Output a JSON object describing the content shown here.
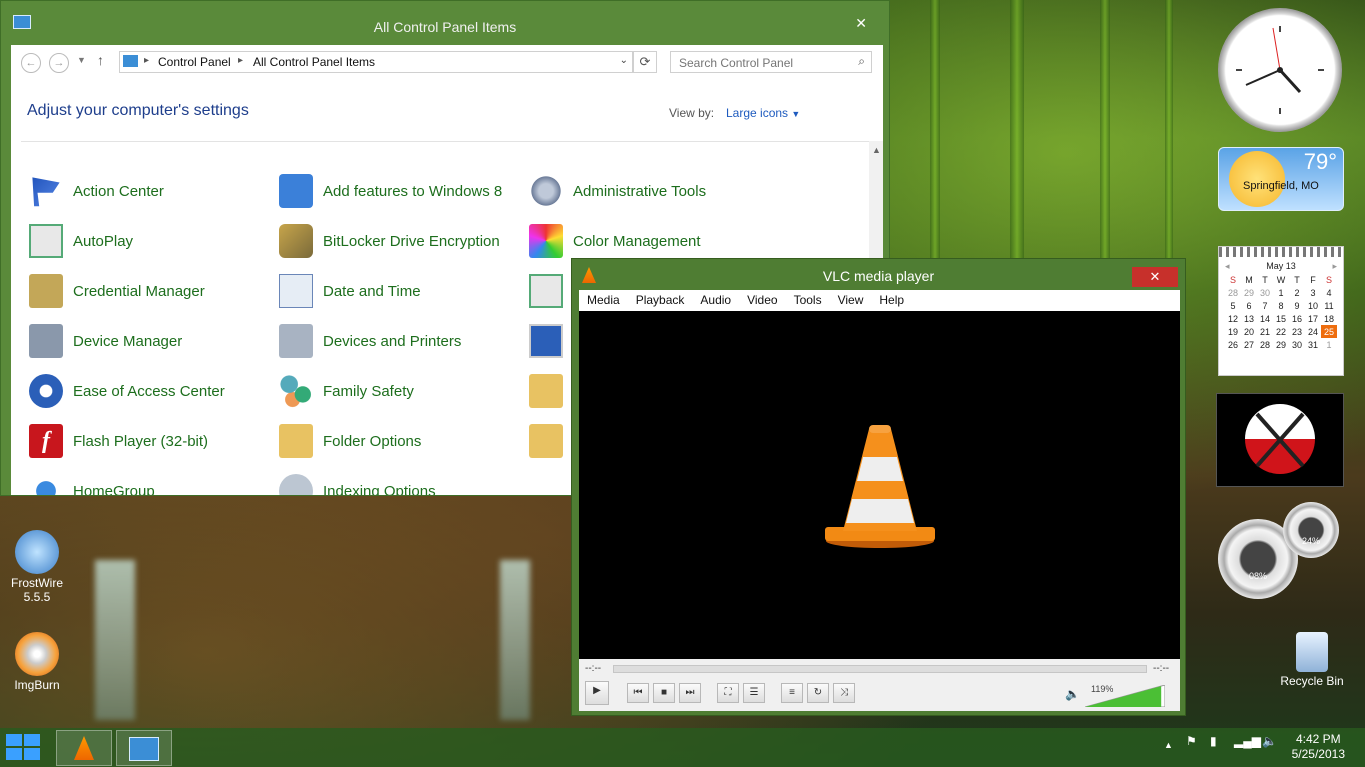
{
  "control_panel": {
    "title": "All Control Panel Items",
    "close_glyph": "✕",
    "breadcrumb": [
      "Control Panel",
      "All Control Panel Items"
    ],
    "search_placeholder": "Search Control Panel",
    "heading": "Adjust your computer's settings",
    "view_by_label": "View by:",
    "view_by_value": "Large icons",
    "items": [
      {
        "label": "Action Center",
        "icon": "action-center-flag-icon"
      },
      {
        "label": "Add features to Windows 8",
        "icon": "add-features-icon"
      },
      {
        "label": "Administrative Tools",
        "icon": "administrative-tools-icon"
      },
      {
        "label": "AutoPlay",
        "icon": "autoplay-icon"
      },
      {
        "label": "BitLocker Drive Encryption",
        "icon": "bitlocker-key-icon"
      },
      {
        "label": "Color Management",
        "icon": "color-management-icon"
      },
      {
        "label": "Credential Manager",
        "icon": "credential-safe-icon"
      },
      {
        "label": "Date and Time",
        "icon": "date-time-icon"
      },
      {
        "label": "",
        "icon": "monitor-check-icon"
      },
      {
        "label": "Device Manager",
        "icon": "device-manager-icon"
      },
      {
        "label": "Devices and Printers",
        "icon": "devices-printers-icon"
      },
      {
        "label": "",
        "icon": "display-icon"
      },
      {
        "label": "Ease of Access Center",
        "icon": "ease-of-access-icon"
      },
      {
        "label": "Family Safety",
        "icon": "family-safety-icon"
      },
      {
        "label": "",
        "icon": "file-history-icon"
      },
      {
        "label": "Flash Player (32-bit)",
        "icon": "flash-player-icon"
      },
      {
        "label": "Folder Options",
        "icon": "folder-options-icon"
      },
      {
        "label": "",
        "icon": "fonts-icon"
      },
      {
        "label": "HomeGroup",
        "icon": "homegroup-icon"
      },
      {
        "label": "Indexing Options",
        "icon": "indexing-options-icon"
      }
    ]
  },
  "vlc": {
    "title": "VLC media player",
    "close_glyph": "✕",
    "menu": [
      "Media",
      "Playback",
      "Audio",
      "Video",
      "Tools",
      "View",
      "Help"
    ],
    "time_elapsed": "--:--",
    "time_total": "--:--",
    "volume_text": "119%",
    "volume_level_percent": 119
  },
  "gadgets": {
    "weather_temp": "79°",
    "weather_city": "Springfield, MO",
    "calendar_month": "May 13",
    "calendar_days_header": [
      "S",
      "M",
      "T",
      "W",
      "T",
      "F",
      "S"
    ],
    "calendar_weeks": [
      [
        "28",
        "29",
        "30",
        "1",
        "2",
        "3",
        "4"
      ],
      [
        "5",
        "6",
        "7",
        "8",
        "9",
        "10",
        "11"
      ],
      [
        "12",
        "13",
        "14",
        "15",
        "16",
        "17",
        "18"
      ],
      [
        "19",
        "20",
        "21",
        "22",
        "23",
        "24",
        "25"
      ],
      [
        "26",
        "27",
        "28",
        "29",
        "30",
        "31",
        "1"
      ]
    ],
    "calendar_today": "25",
    "cpu_meter": "08%",
    "mem_meter": "24%"
  },
  "desktop_icons": [
    {
      "label": "FrostWire 5.5.5"
    },
    {
      "label": "ImgBurn"
    },
    {
      "label": "Recycle Bin"
    }
  ],
  "taskbar": {
    "time": "4:42 PM",
    "date": "5/25/2013"
  }
}
